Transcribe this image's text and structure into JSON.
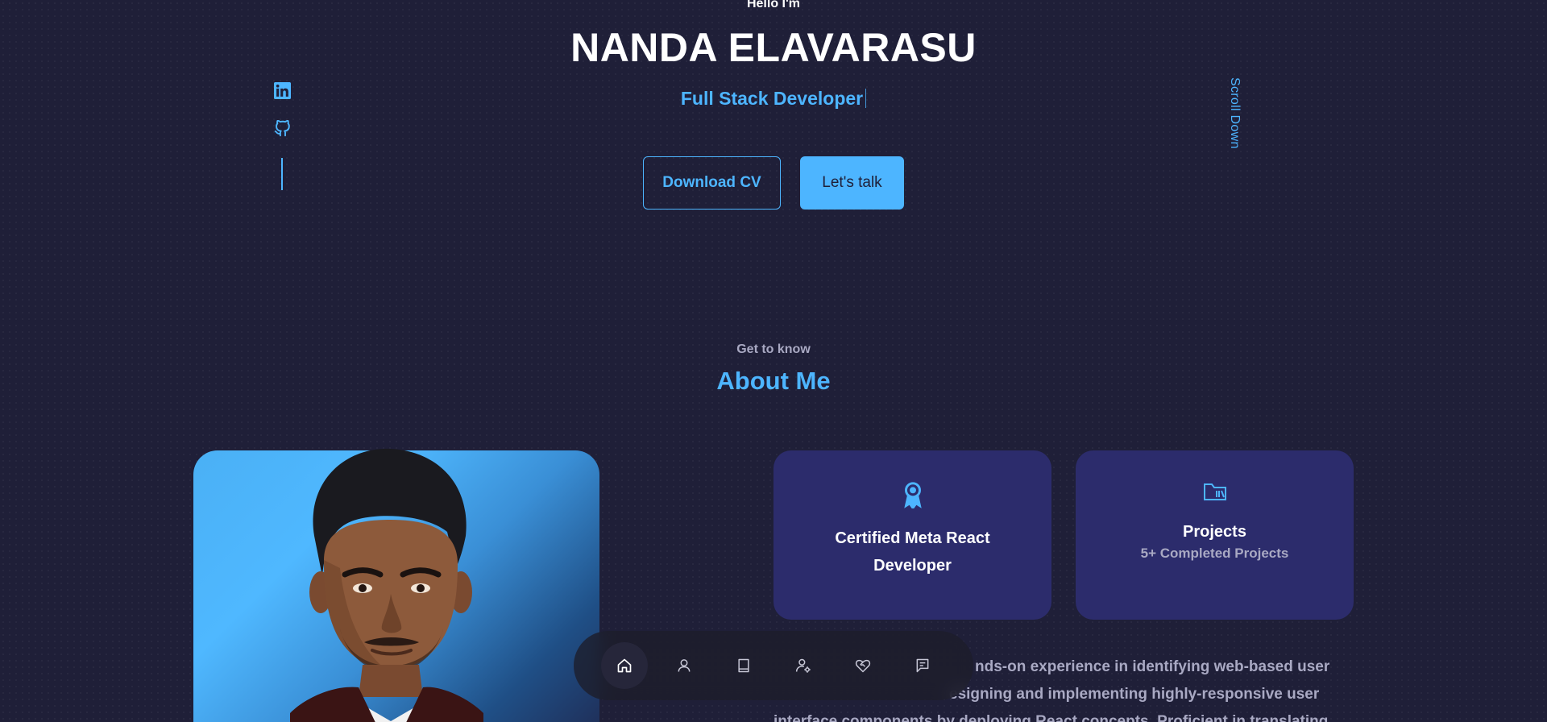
{
  "hero": {
    "greeting": "Hello I'm",
    "name": "NANDA ELAVARASU",
    "role": "Full Stack Developer",
    "download_cv": "Download CV",
    "lets_talk": "Let's talk",
    "scroll_down": "Scroll Down"
  },
  "socials": {
    "icons": [
      "linkedin-icon",
      "github-icon"
    ]
  },
  "about": {
    "subtitle": "Get to know",
    "title": "About Me",
    "cards": [
      {
        "icon": "award-icon",
        "title_line1": "Certified Meta React",
        "title_line2": "Developer",
        "subtitle": ""
      },
      {
        "icon": "folder-icon",
        "title_line1": "Projects",
        "title_line2": "",
        "subtitle": "5+ Completed Projects"
      }
    ],
    "text_line1": "nds-on experience in identifying web-based user",
    "text_line2": "esigning and implementing highly-responsive user",
    "text_line3": "interface components by deploying React concepts. Proficient in translating"
  },
  "nav": {
    "items": [
      "home-icon",
      "user-icon",
      "book-icon",
      "user-gear-icon",
      "heart-handshake-icon",
      "message-icon"
    ],
    "active": "home-icon"
  },
  "colors": {
    "background": "#1f1f38",
    "primary": "#4db5ff",
    "card": "#2c2c6c",
    "muted": "#a9a9c3"
  }
}
